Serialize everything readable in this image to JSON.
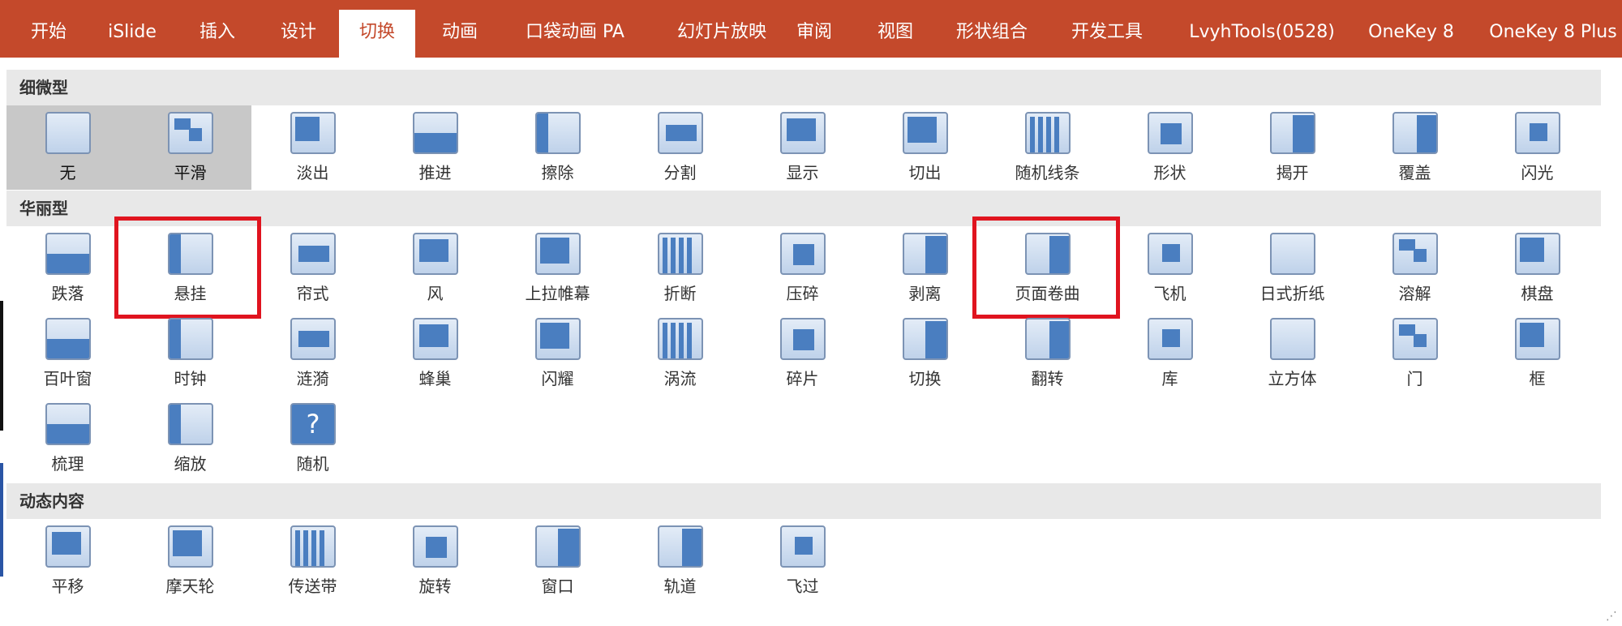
{
  "ribbon": {
    "tabs": [
      {
        "label": "开始"
      },
      {
        "label": "iSlide"
      },
      {
        "label": "插入"
      },
      {
        "label": "设计"
      },
      {
        "label": "切换",
        "active": true
      },
      {
        "label": "动画"
      },
      {
        "label": "口袋动画 PA"
      },
      {
        "label": "幻灯片放映"
      },
      {
        "label": "审阅"
      },
      {
        "label": "视图"
      },
      {
        "label": "形状组合"
      },
      {
        "label": "开发工具"
      },
      {
        "label": "LvyhTools(0528)"
      },
      {
        "label": "OneKey 8"
      },
      {
        "label": "OneKey 8 Plus"
      }
    ]
  },
  "gallery": {
    "sections": [
      {
        "title": "细微型",
        "items": [
          "无",
          "平滑",
          "淡出",
          "推进",
          "擦除",
          "分割",
          "显示",
          "切出",
          "随机线条",
          "形状",
          "揭开",
          "覆盖",
          "闪光"
        ]
      },
      {
        "title": "华丽型",
        "items": [
          "跌落",
          "悬挂",
          "帘式",
          "风",
          "上拉帷幕",
          "折断",
          "压碎",
          "剥离",
          "页面卷曲",
          "飞机",
          "日式折纸",
          "溶解",
          "棋盘",
          "百叶窗",
          "时钟",
          "涟漪",
          "蜂巢",
          "闪耀",
          "涡流",
          "碎片",
          "切换",
          "翻转",
          "库",
          "立方体",
          "门",
          "框",
          "梳理",
          "缩放",
          "随机"
        ]
      },
      {
        "title": "动态内容",
        "items": [
          "平移",
          "摩天轮",
          "传送带",
          "旋转",
          "窗口",
          "轨道",
          "飞过"
        ]
      }
    ],
    "selected": [
      "无",
      "平滑"
    ],
    "highlighted": [
      "悬挂",
      "页面卷曲"
    ]
  },
  "colors": {
    "ribbon_bg": "#c4492b",
    "header_bg": "#e8e8e8",
    "selected_bg": "#c8c8c8",
    "highlight": "#e0141f",
    "icon_blue": "#4a7ec0"
  }
}
